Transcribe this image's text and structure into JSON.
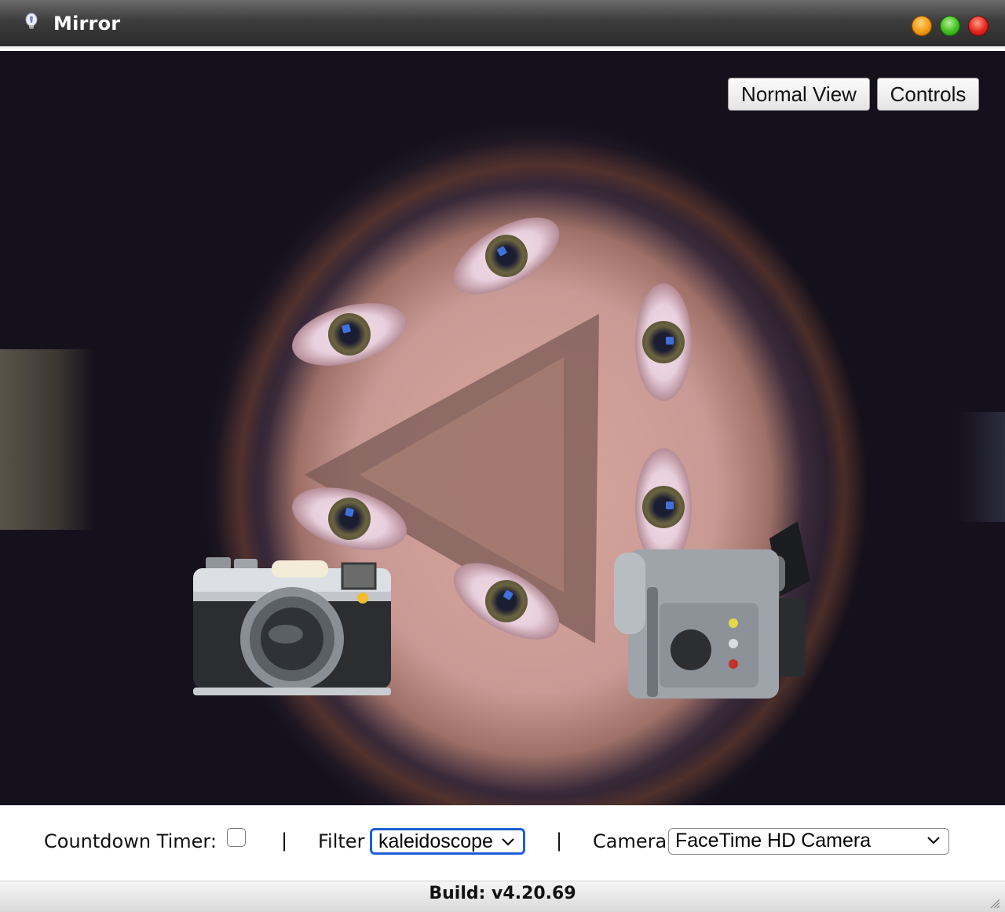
{
  "window": {
    "title": "Mirror",
    "icon": "lightbulb-icon"
  },
  "viewport": {
    "filter_effect": "kaleidoscope",
    "buttons": {
      "normal_view": "Normal View",
      "controls": "Controls"
    },
    "take_photo_icon": "camera-icon",
    "record_video_icon": "video-camera-icon"
  },
  "controls": {
    "countdown_label": "Countdown Timer:",
    "countdown_checked": false,
    "separator": "|",
    "filter_label": "Filter",
    "filter_value": "kaleidoscope",
    "camera_label": "Camera",
    "camera_value": "FaceTime HD Camera"
  },
  "status": {
    "build": "Build: v4.20.69"
  },
  "colors": {
    "focus_ring": "#1f5fd6",
    "titlebar": "#3c3c3c"
  }
}
